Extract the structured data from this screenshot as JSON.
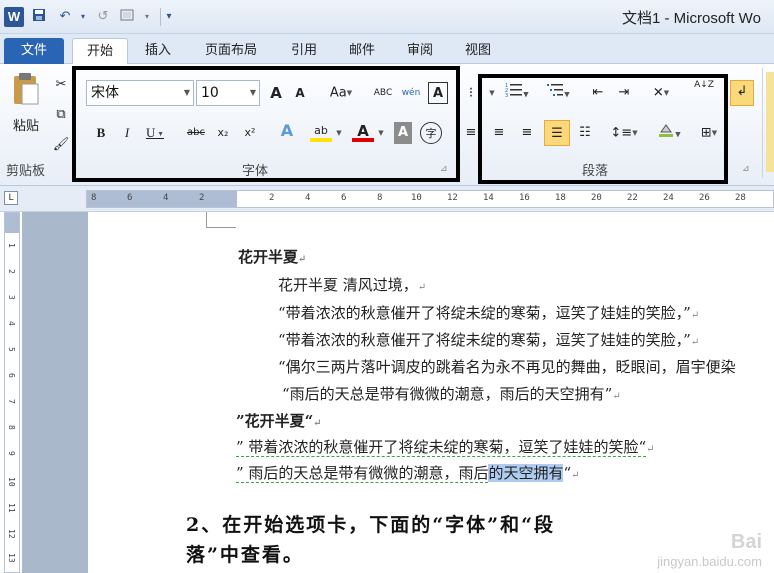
{
  "app": {
    "logo": "W",
    "title": "文档1 - Microsoft Wo"
  },
  "quick_access": {
    "save": "save-icon",
    "undo": "↶",
    "redo": "↺",
    "print": "print-preview-icon",
    "customize": "▾"
  },
  "tabs": [
    {
      "label": "文件",
      "active": false
    },
    {
      "label": "开始",
      "active": true
    },
    {
      "label": "插入",
      "active": false
    },
    {
      "label": "页面布局",
      "active": false
    },
    {
      "label": "引用",
      "active": false
    },
    {
      "label": "邮件",
      "active": false
    },
    {
      "label": "审阅",
      "active": false
    },
    {
      "label": "视图",
      "active": false
    }
  ],
  "clipboard": {
    "paste_label": "粘贴",
    "group_label": "剪贴板"
  },
  "font_group": {
    "font_name": "宋体",
    "font_size": "10",
    "grow": "A",
    "shrink": "A",
    "change_case": "Aa",
    "clear_format": "ABC",
    "phonetic": "wén",
    "char_border": "A",
    "bold": "B",
    "italic": "I",
    "underline": "U",
    "strike": "abc",
    "subscript": "x₂",
    "superscript": "x²",
    "text_effect": "A",
    "highlight": "ab",
    "font_color": "A",
    "char_shading": "A",
    "enclose": "字",
    "group_label": "字体"
  },
  "paragraph_group": {
    "group_label": "段落",
    "sort": "A↓Z"
  },
  "ruler": {
    "corner": "L",
    "h_ticks": [
      "8",
      "6",
      "4",
      "2",
      "2",
      "4",
      "6",
      "8",
      "10",
      "12",
      "14",
      "16",
      "18",
      "20",
      "22",
      "24",
      "26",
      "28",
      "30",
      "32"
    ],
    "v_ticks": [
      "1",
      "2",
      "3",
      "4",
      "5",
      "6",
      "7",
      "8",
      "9",
      "10",
      "11",
      "12",
      "13"
    ]
  },
  "document": {
    "lines": [
      "花开半夏",
      "花开半夏 清风过境，",
      "“带着浓浓的秋意催开了将绽未绽的寒菊，逗笑了娃娃的笑脸，”",
      "“带着浓浓的秋意催开了将绽未绽的寒菊，逗笑了娃娃的笑脸，”",
      "“偶尔三两片落叶调皮的跳着名为永不再见的舞曲，眨眼间，眉宇便染",
      "“雨后的天总是带有微微的潮意，雨后的天空拥有”",
      "”花开半夏“",
      "” 带着浓浓的秋意催开了将绽未绽的寒菊，逗笑了娃娃的笑脸“",
      "” 雨后的天总是带有微微的潮意，雨后",
      "的天空拥有",
      "“"
    ],
    "paragraph_mark": "↵",
    "heading_line1": "2、在开始选项卡，下面的“字体”和“段",
    "heading_line2": "落”中查看。"
  },
  "watermark": {
    "line1": "Bai",
    "line2": "jingyan.baidu.com"
  },
  "colors": {
    "file_tab": "#2a64b4",
    "highlight_border": "#000000",
    "selection": "#aecbf0",
    "word_logo": "#2b5797"
  }
}
